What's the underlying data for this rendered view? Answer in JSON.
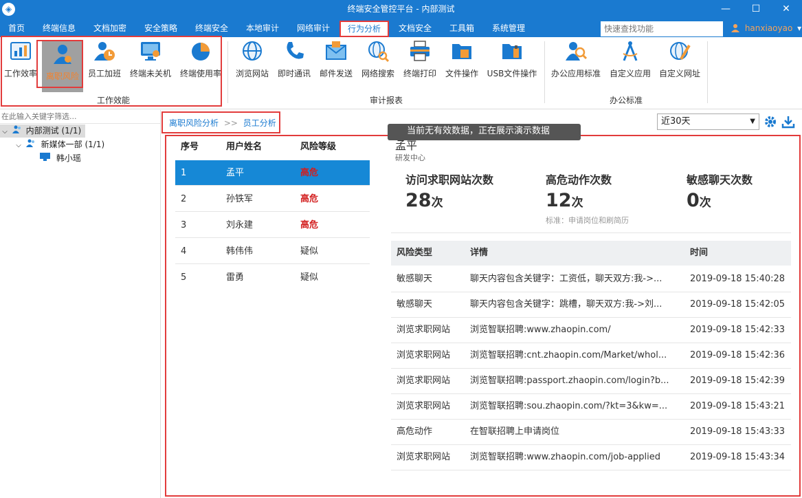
{
  "window": {
    "title": "终端安全管控平台 - 内部测试",
    "min": "—",
    "max": "☐",
    "close": "✕"
  },
  "menu": {
    "items": [
      "首页",
      "终端信息",
      "文档加密",
      "安全策略",
      "终端安全",
      "本地审计",
      "网络审计",
      "行为分析",
      "文档安全",
      "工具箱",
      "系统管理"
    ],
    "active_index": 7,
    "search_placeholder": "快速查找功能",
    "user": "hanxiaoyao",
    "user_caret": "▾"
  },
  "ribbon": {
    "groups": [
      {
        "label": "工作效能",
        "buttons": [
          "工作效率",
          "离职风险",
          "员工加班",
          "终端未关机",
          "终端使用率"
        ]
      },
      {
        "label": "审计报表",
        "buttons": [
          "浏览网站",
          "即时通讯",
          "邮件发送",
          "网络搜索",
          "终端打印",
          "文件操作",
          "USB文件操作"
        ]
      },
      {
        "label": "办公标准",
        "buttons": [
          "办公应用标准",
          "自定义应用",
          "自定义网址"
        ]
      }
    ],
    "selected": "离职风险"
  },
  "sidebar": {
    "filter_placeholder": "在此输入关键字筛选...",
    "tree": [
      {
        "label": "内部测试 (1/1)",
        "level": 0,
        "selected": true
      },
      {
        "label": "新媒体一部 (1/1)",
        "level": 1
      },
      {
        "label": "韩小瑶",
        "level": 2
      }
    ]
  },
  "content": {
    "breadcrumb": {
      "parent": "离职风险分析",
      "sep": ">>",
      "current": "员工分析"
    },
    "period": "近30天",
    "toast": "当前无有效数据，正在展示演示数据",
    "user_table": {
      "headers": [
        "序号",
        "用户姓名",
        "风险等级"
      ],
      "rows": [
        {
          "no": "1",
          "name": "孟平",
          "risk": "高危",
          "level": "high"
        },
        {
          "no": "2",
          "name": "孙铁军",
          "risk": "高危",
          "level": "high"
        },
        {
          "no": "3",
          "name": "刘永建",
          "risk": "高危",
          "level": "high"
        },
        {
          "no": "4",
          "name": "韩伟伟",
          "risk": "疑似",
          "level": "suspect"
        },
        {
          "no": "5",
          "name": "雷勇",
          "risk": "疑似",
          "level": "suspect"
        }
      ],
      "selected_index": 0
    },
    "person": {
      "name": "孟平",
      "dept": "研发中心"
    },
    "stats": [
      {
        "label": "访问求职网站次数",
        "value": "28",
        "unit": "次"
      },
      {
        "label": "高危动作次数",
        "value": "12",
        "unit": "次"
      },
      {
        "label": "敏感聊天次数",
        "value": "0",
        "unit": "次"
      }
    ],
    "stat_note": "标准：申请岗位和刷简历",
    "detail_table": {
      "headers": [
        "风险类型",
        "详情",
        "时间"
      ],
      "rows": [
        {
          "type": "敏感聊天",
          "detail": "聊天内容包含关键字：工资低，聊天双方:我->...",
          "time": "2019-09-18 15:40:28"
        },
        {
          "type": "敏感聊天",
          "detail": "聊天内容包含关键字：跳槽，聊天双方:我->刘...",
          "time": "2019-09-18 15:42:05"
        },
        {
          "type": "浏览求职网站",
          "detail": "浏览智联招聘:www.zhaopin.com/",
          "time": "2019-09-18 15:42:33"
        },
        {
          "type": "浏览求职网站",
          "detail": "浏览智联招聘:cnt.zhaopin.com/Market/whol...",
          "time": "2019-09-18 15:42:36"
        },
        {
          "type": "浏览求职网站",
          "detail": "浏览智联招聘:passport.zhaopin.com/login?b...",
          "time": "2019-09-18 15:42:39"
        },
        {
          "type": "浏览求职网站",
          "detail": "浏览智联招聘:sou.zhaopin.com/?kt=3&kw=...",
          "time": "2019-09-18 15:43:21"
        },
        {
          "type": "高危动作",
          "detail": "在智联招聘上申请岗位",
          "time": "2019-09-18 15:43:33"
        },
        {
          "type": "浏览求职网站",
          "detail": "浏览智联招聘:www.zhaopin.com/job-applied",
          "time": "2019-09-18 15:43:34"
        }
      ]
    }
  },
  "colors": {
    "accent": "#1a7ad0",
    "highlight": "#e23b3b",
    "row_selected": "#1688d6",
    "risk_high": "#d21d1d"
  }
}
